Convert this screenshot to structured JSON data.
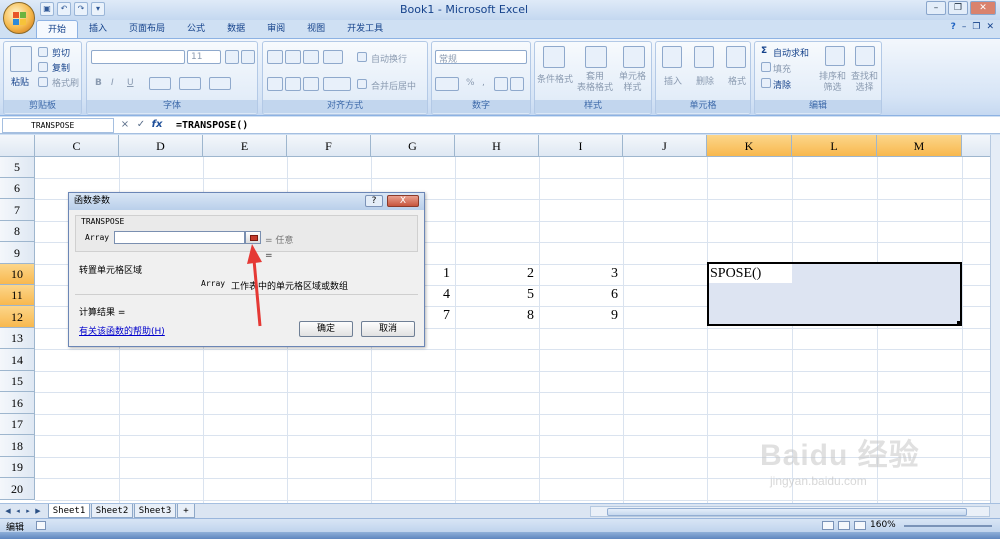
{
  "window": {
    "title": "Book1 - Microsoft Excel"
  },
  "tabs": [
    "开始",
    "插入",
    "页面布局",
    "公式",
    "数据",
    "审阅",
    "视图",
    "开发工具"
  ],
  "ribbon": {
    "clipboard": {
      "paste": "粘贴",
      "cut": "剪切",
      "copy": "复制",
      "format_painter": "格式刷",
      "label": "剪贴板"
    },
    "font": {
      "size": "11",
      "bold": "B",
      "italic": "I",
      "underline": "U",
      "label": "字体"
    },
    "alignment": {
      "wrap_text": "自动换行",
      "merge_center": "合并后居中",
      "label": "对齐方式"
    },
    "number": {
      "format": "常规",
      "percent": "%",
      "comma": ",",
      "label": "数字"
    },
    "styles": {
      "conditional": "条件格式",
      "table_format": "套用\n表格格式",
      "cell_styles": "单元格\n样式",
      "label": "样式"
    },
    "cells": {
      "insert": "插入",
      "delete": "删除",
      "format": "格式",
      "label": "单元格"
    },
    "editing": {
      "autosum": "自动求和",
      "fill": "填充",
      "clear": "清除",
      "sort_filter": "排序和\n筛选",
      "find_select": "查找和\n选择",
      "label": "编辑"
    }
  },
  "formula_bar": {
    "name_box": "TRANSPOSE",
    "cancel": "×",
    "enter": "✓",
    "fx": "fx",
    "formula": "=TRANSPOSE()"
  },
  "grid": {
    "columns": [
      "C",
      "D",
      "E",
      "F",
      "G",
      "H",
      "I",
      "J",
      "K",
      "L",
      "M"
    ],
    "rows": [
      "5",
      "6",
      "7",
      "8",
      "9",
      "10",
      "11",
      "12",
      "13",
      "14",
      "15",
      "16",
      "17",
      "18",
      "19",
      "20"
    ],
    "values": {
      "G10": "1",
      "H10": "2",
      "I10": "3",
      "G11": "4",
      "H11": "5",
      "I11": "6",
      "G12": "7",
      "H12": "8",
      "I12": "9",
      "K10": "SPOSE()"
    }
  },
  "dialog": {
    "title": "函数参数",
    "help": "?",
    "close": "X",
    "function_name": "TRANSPOSE",
    "arg_label": "Array",
    "arg_value": "",
    "arg_hint": "= 任意",
    "result_eq": "=",
    "description": "转置单元格区域",
    "arg_description_name": "Array",
    "arg_description": "工作表中的单元格区域或数组",
    "calc_result": "计算结果 =",
    "help_link": "有关该函数的帮助(H)",
    "ok": "确定",
    "cancel": "取消"
  },
  "sheets": [
    "Sheet1",
    "Sheet2",
    "Sheet3"
  ],
  "status": {
    "mode": "编辑",
    "zoom": "160%"
  },
  "watermark": {
    "logo": "Baidu 经验",
    "url": "jingyan.baidu.com"
  },
  "colors": {
    "accent": "#15428b",
    "selected_header": "#f8b84e",
    "arrow": "#e53935"
  }
}
